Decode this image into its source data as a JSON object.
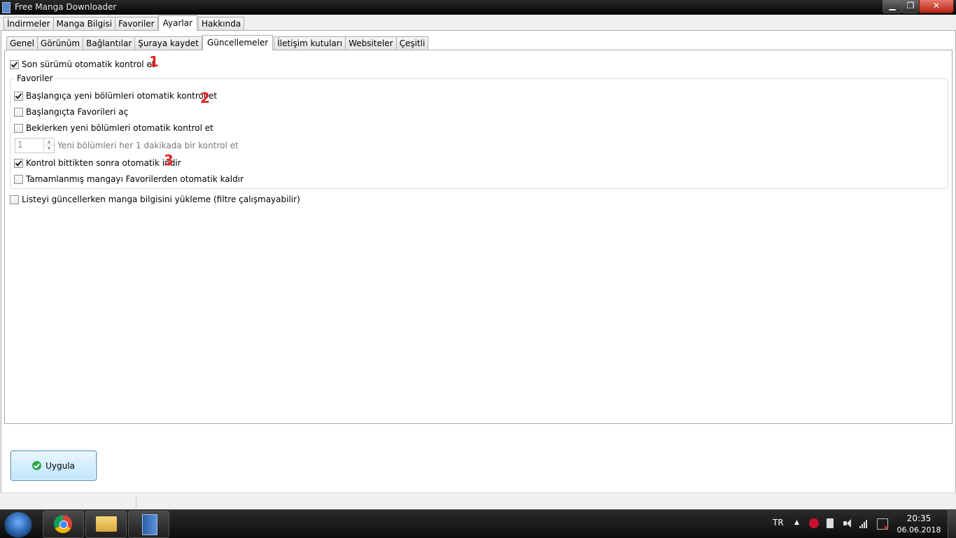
{
  "window": {
    "title": "Free Manga Downloader",
    "min_icon": "minimize-icon",
    "max_icon": "maximize-icon",
    "close_icon": "close-icon"
  },
  "main_tabs": [
    "İndirmeler",
    "Manga Bilgisi",
    "Favoriler",
    "Ayarlar",
    "Hakkında"
  ],
  "main_tab_active": "Ayarlar",
  "sub_tabs": [
    "Genel",
    "Görünüm",
    "Bağlantılar",
    "Şuraya kaydet",
    "Güncellemeler",
    "İletişim kutuları",
    "Websiteler",
    "Çeşitli"
  ],
  "sub_tab_active": "Güncellemeler",
  "settings": {
    "auto_check_latest": {
      "label": "Son sürümü otomatik kontrol et",
      "checked": true
    },
    "favorites": {
      "legend": "Favoriler",
      "check_new_on_start": {
        "label": "Başlangıça yeni bölümleri otomatik kontrol et",
        "checked": true
      },
      "open_on_start": {
        "label": "Başlangıçta Favorileri aç",
        "checked": false
      },
      "check_while_idle": {
        "label": "Beklerken yeni bölümleri otomatik kontrol et",
        "checked": false
      },
      "interval_value": "1",
      "interval_label": "Yeni bölümleri her 1 dakikada bir kontrol et",
      "auto_download": {
        "label": "Kontrol bittikten sonra otomatik indir",
        "checked": true
      },
      "auto_remove_completed": {
        "label": "Tamamlanmış mangayı Favorilerden otomatik kaldır",
        "checked": false
      }
    },
    "skip_manga_info": {
      "label": "Listeyi güncellerken manga bilgisini yükleme (filtre çalışmayabilir)",
      "checked": false
    }
  },
  "annotations": {
    "m1": "1",
    "m2": "2",
    "m3": "3",
    "color": "#e02828"
  },
  "apply_button": {
    "label": "Uygula",
    "icon": "check-circle-icon"
  },
  "taskbar": {
    "items": [
      "chrome-icon",
      "file-explorer-icon",
      "free-manga-downloader-icon"
    ],
    "language": "TR",
    "time": "20:35",
    "date": "06.06.2018"
  }
}
